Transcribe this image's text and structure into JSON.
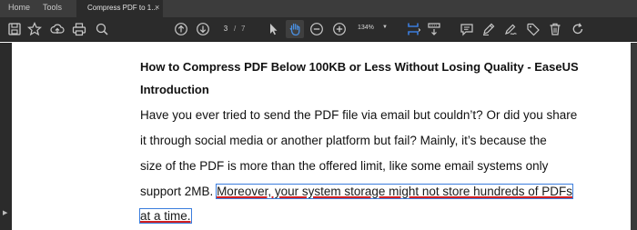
{
  "tabs": {
    "home": "Home",
    "tools": "Tools",
    "document": "Compress PDF to 1...",
    "close": "×"
  },
  "toolbar": {
    "page_current": "3",
    "page_separator": "/",
    "page_total": "7",
    "zoom": "134%",
    "icons": [
      "save-icon",
      "bookmark-star-icon",
      "cloud-upload-icon",
      "print-icon",
      "zoom-search-icon",
      "page-up-icon",
      "page-down-icon",
      "select-pointer-icon",
      "hand-tool-icon",
      "zoom-out-icon",
      "zoom-in-icon",
      "fit-page-icon",
      "scroll-mode-icon",
      "comment-icon",
      "highlight-pen-icon",
      "sign-icon",
      "tag-icon",
      "delete-icon",
      "rotate-icon"
    ]
  },
  "document": {
    "title": "How to Compress PDF Below 100KB or Less Without Losing Quality - EaseUS",
    "heading": "Introduction",
    "line1": "Have you ever tried to send the PDF file via email but couldn’t? Or did you share",
    "line2": "it through social media or another platform but fail? Mainly, it’s because the",
    "line3": "size of the PDF is more than the offered limit, like some email systems only",
    "line4_plain": "support 2MB.",
    "line4_highlight": "Moreover, your system storage might not store hundreds of PDFs",
    "line5_highlight": "at a time."
  },
  "colors": {
    "chrome": "#2b2b2b",
    "tabbar": "#3c3c3c",
    "highlight_outline": "#3b7ddd",
    "highlight_underline": "#d32020",
    "fit_page_accent": "#3b7ddd",
    "hand_accent": "#4a90e2"
  }
}
